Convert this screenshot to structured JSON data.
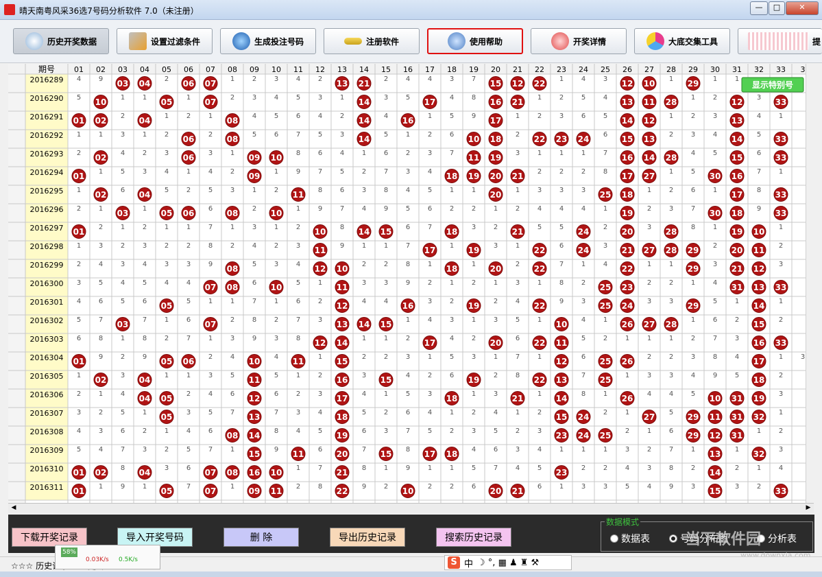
{
  "window": {
    "title": "晴天南粤风采36选7号码分析软件 7.0（未注册）",
    "controls": [
      "—",
      "□",
      "✕"
    ]
  },
  "toolbar": [
    {
      "label": "历史开奖数据",
      "icon": "history-icon",
      "pressed": true
    },
    {
      "label": "设置过滤条件",
      "icon": "tools-icon"
    },
    {
      "label": "生成投注号码",
      "icon": "globe-icon"
    },
    {
      "label": "注册软件",
      "icon": "key-icon"
    },
    {
      "label": "使用帮助",
      "icon": "help-icon",
      "highlight": true
    },
    {
      "label": "开奖详情",
      "icon": "question-icon"
    },
    {
      "label": "大底交集工具",
      "icon": "shapes-icon"
    },
    {
      "label": "提",
      "icon": "grid-icon"
    }
  ],
  "grid": {
    "header_period": "期号",
    "columns": [
      "01",
      "02",
      "03",
      "04",
      "05",
      "06",
      "07",
      "08",
      "09",
      "10",
      "11",
      "12",
      "13",
      "14",
      "15",
      "16",
      "17",
      "18",
      "19",
      "20",
      "21",
      "22",
      "23",
      "24",
      "25",
      "26",
      "27",
      "28",
      "29",
      "30",
      "31",
      "32",
      "33",
      "3"
    ],
    "show_special_label": "显示特别号",
    "rows": [
      {
        "period": "2016289",
        "cells": [
          "4",
          "9",
          "03",
          "04",
          "2",
          "06",
          "07",
          "1",
          "2",
          "3",
          "4",
          "2",
          "13",
          "21",
          "2",
          "4",
          "4",
          "3",
          "7",
          "15",
          "12",
          "22",
          "1",
          "4",
          "3",
          "12",
          "10",
          "1",
          "29",
          "1",
          "1",
          "",
          "",
          ""
        ]
      },
      {
        "period": "2016290",
        "cells": [
          "5",
          "10",
          "1",
          "1",
          "05",
          "1",
          "07",
          "2",
          "3",
          "4",
          "5",
          "3",
          "1",
          "14",
          "3",
          "5",
          "17",
          "4",
          "8",
          "16",
          "21",
          "1",
          "2",
          "5",
          "4",
          "13",
          "11",
          "28",
          "1",
          "2",
          "12",
          "3",
          "33",
          ""
        ]
      },
      {
        "period": "2016291",
        "cells": [
          "01",
          "02",
          "2",
          "04",
          "1",
          "2",
          "1",
          "08",
          "4",
          "5",
          "6",
          "4",
          "2",
          "14",
          "4",
          "16",
          "1",
          "5",
          "9",
          "17",
          "1",
          "2",
          "3",
          "6",
          "5",
          "14",
          "12",
          "1",
          "2",
          "3",
          "13",
          "4",
          "1",
          ""
        ]
      },
      {
        "period": "2016292",
        "cells": [
          "1",
          "1",
          "3",
          "1",
          "2",
          "06",
          "2",
          "08",
          "5",
          "6",
          "7",
          "5",
          "3",
          "14",
          "5",
          "1",
          "2",
          "6",
          "10",
          "18",
          "2",
          "22",
          "23",
          "24",
          "6",
          "15",
          "13",
          "2",
          "3",
          "4",
          "14",
          "5",
          "33",
          ""
        ]
      },
      {
        "period": "2016293",
        "cells": [
          "2",
          "02",
          "4",
          "2",
          "3",
          "06",
          "3",
          "1",
          "09",
          "10",
          "8",
          "6",
          "4",
          "1",
          "6",
          "2",
          "3",
          "7",
          "11",
          "19",
          "3",
          "1",
          "1",
          "1",
          "7",
          "16",
          "14",
          "28",
          "4",
          "5",
          "15",
          "6",
          "33",
          ""
        ]
      },
      {
        "period": "2016294",
        "cells": [
          "01",
          "1",
          "5",
          "3",
          "4",
          "1",
          "4",
          "2",
          "09",
          "1",
          "9",
          "7",
          "5",
          "2",
          "7",
          "3",
          "4",
          "18",
          "19",
          "20",
          "21",
          "2",
          "2",
          "2",
          "8",
          "17",
          "27",
          "1",
          "5",
          "30",
          "16",
          "7",
          "1",
          ""
        ]
      },
      {
        "period": "2016295",
        "cells": [
          "1",
          "02",
          "6",
          "04",
          "5",
          "2",
          "5",
          "3",
          "1",
          "2",
          "11",
          "8",
          "6",
          "3",
          "8",
          "4",
          "5",
          "1",
          "1",
          "20",
          "1",
          "3",
          "3",
          "3",
          "25",
          "18",
          "1",
          "2",
          "6",
          "1",
          "17",
          "8",
          "33",
          ""
        ]
      },
      {
        "period": "2016296",
        "cells": [
          "2",
          "1",
          "03",
          "1",
          "05",
          "06",
          "6",
          "08",
          "2",
          "10",
          "1",
          "9",
          "7",
          "4",
          "9",
          "5",
          "6",
          "2",
          "2",
          "1",
          "2",
          "4",
          "4",
          "4",
          "1",
          "19",
          "2",
          "3",
          "7",
          "30",
          "18",
          "9",
          "33",
          ""
        ]
      },
      {
        "period": "2016297",
        "cells": [
          "01",
          "2",
          "1",
          "2",
          "1",
          "1",
          "7",
          "1",
          "3",
          "1",
          "2",
          "10",
          "8",
          "14",
          "15",
          "6",
          "7",
          "18",
          "3",
          "2",
          "21",
          "5",
          "5",
          "24",
          "2",
          "20",
          "3",
          "28",
          "8",
          "1",
          "19",
          "10",
          "1",
          ""
        ]
      },
      {
        "period": "2016298",
        "cells": [
          "1",
          "3",
          "2",
          "3",
          "2",
          "2",
          "8",
          "2",
          "4",
          "2",
          "3",
          "11",
          "9",
          "1",
          "1",
          "7",
          "17",
          "1",
          "19",
          "3",
          "1",
          "22",
          "6",
          "24",
          "3",
          "21",
          "27",
          "28",
          "29",
          "2",
          "20",
          "11",
          "2",
          ""
        ]
      },
      {
        "period": "2016299",
        "cells": [
          "2",
          "4",
          "3",
          "4",
          "3",
          "3",
          "9",
          "08",
          "5",
          "3",
          "4",
          "12",
          "10",
          "2",
          "2",
          "8",
          "1",
          "18",
          "1",
          "20",
          "2",
          "22",
          "7",
          "1",
          "4",
          "22",
          "1",
          "1",
          "29",
          "3",
          "21",
          "12",
          "3",
          ""
        ]
      },
      {
        "period": "2016300",
        "cells": [
          "3",
          "5",
          "4",
          "5",
          "4",
          "4",
          "07",
          "08",
          "6",
          "10",
          "5",
          "1",
          "11",
          "3",
          "3",
          "9",
          "2",
          "1",
          "2",
          "1",
          "3",
          "1",
          "8",
          "2",
          "25",
          "23",
          "2",
          "2",
          "1",
          "4",
          "31",
          "13",
          "33",
          ""
        ]
      },
      {
        "period": "2016301",
        "cells": [
          "4",
          "6",
          "5",
          "6",
          "05",
          "5",
          "1",
          "1",
          "7",
          "1",
          "6",
          "2",
          "12",
          "4",
          "4",
          "16",
          "3",
          "2",
          "19",
          "2",
          "4",
          "22",
          "9",
          "3",
          "25",
          "24",
          "3",
          "3",
          "29",
          "5",
          "1",
          "14",
          "1",
          ""
        ]
      },
      {
        "period": "2016302",
        "cells": [
          "5",
          "7",
          "03",
          "7",
          "1",
          "6",
          "07",
          "2",
          "8",
          "2",
          "7",
          "3",
          "13",
          "14",
          "15",
          "1",
          "4",
          "3",
          "1",
          "3",
          "5",
          "1",
          "10",
          "4",
          "1",
          "26",
          "27",
          "28",
          "1",
          "6",
          "2",
          "15",
          "2",
          ""
        ]
      },
      {
        "period": "2016303",
        "cells": [
          "6",
          "8",
          "1",
          "8",
          "2",
          "7",
          "1",
          "3",
          "9",
          "3",
          "8",
          "12",
          "14",
          "1",
          "1",
          "2",
          "17",
          "4",
          "2",
          "20",
          "6",
          "22",
          "11",
          "5",
          "2",
          "1",
          "1",
          "1",
          "2",
          "7",
          "3",
          "16",
          "33",
          ""
        ]
      },
      {
        "period": "2016304",
        "cells": [
          "01",
          "9",
          "2",
          "9",
          "05",
          "06",
          "2",
          "4",
          "10",
          "4",
          "11",
          "1",
          "15",
          "2",
          "2",
          "3",
          "1",
          "5",
          "3",
          "1",
          "7",
          "1",
          "12",
          "6",
          "25",
          "26",
          "2",
          "2",
          "3",
          "8",
          "4",
          "17",
          "1",
          "3"
        ]
      },
      {
        "period": "2016305",
        "cells": [
          "1",
          "02",
          "3",
          "04",
          "1",
          "1",
          "3",
          "5",
          "11",
          "5",
          "1",
          "2",
          "16",
          "3",
          "15",
          "4",
          "2",
          "6",
          "19",
          "2",
          "8",
          "22",
          "13",
          "7",
          "25",
          "1",
          "3",
          "3",
          "4",
          "9",
          "5",
          "18",
          "2",
          ""
        ]
      },
      {
        "period": "2016306",
        "cells": [
          "2",
          "1",
          "4",
          "04",
          "05",
          "2",
          "4",
          "6",
          "12",
          "6",
          "2",
          "3",
          "17",
          "4",
          "1",
          "5",
          "3",
          "18",
          "1",
          "3",
          "21",
          "1",
          "14",
          "8",
          "1",
          "26",
          "4",
          "4",
          "5",
          "10",
          "31",
          "19",
          "3",
          ""
        ]
      },
      {
        "period": "2016307",
        "cells": [
          "3",
          "2",
          "5",
          "1",
          "05",
          "3",
          "5",
          "7",
          "13",
          "7",
          "3",
          "4",
          "18",
          "5",
          "2",
          "6",
          "4",
          "1",
          "2",
          "4",
          "1",
          "2",
          "15",
          "24",
          "2",
          "1",
          "27",
          "5",
          "29",
          "11",
          "31",
          "32",
          "1",
          ""
        ]
      },
      {
        "period": "2016308",
        "cells": [
          "4",
          "3",
          "6",
          "2",
          "1",
          "4",
          "6",
          "08",
          "14",
          "8",
          "4",
          "5",
          "19",
          "6",
          "3",
          "7",
          "5",
          "2",
          "3",
          "5",
          "2",
          "3",
          "23",
          "24",
          "25",
          "2",
          "1",
          "6",
          "29",
          "12",
          "31",
          "1",
          "2",
          ""
        ]
      },
      {
        "period": "2016309",
        "cells": [
          "5",
          "4",
          "7",
          "3",
          "2",
          "5",
          "7",
          "1",
          "15",
          "9",
          "11",
          "6",
          "20",
          "7",
          "15",
          "8",
          "17",
          "18",
          "4",
          "6",
          "3",
          "4",
          "1",
          "1",
          "1",
          "3",
          "2",
          "7",
          "1",
          "13",
          "1",
          "32",
          "3",
          ""
        ]
      },
      {
        "period": "2016310",
        "cells": [
          "01",
          "02",
          "8",
          "04",
          "3",
          "6",
          "07",
          "08",
          "16",
          "10",
          "1",
          "7",
          "21",
          "8",
          "1",
          "9",
          "1",
          "1",
          "5",
          "7",
          "4",
          "5",
          "23",
          "2",
          "2",
          "4",
          "3",
          "8",
          "2",
          "14",
          "2",
          "1",
          "4",
          ""
        ]
      },
      {
        "period": "2016311",
        "cells": [
          "01",
          "1",
          "9",
          "1",
          "05",
          "7",
          "07",
          "1",
          "09",
          "11",
          "2",
          "8",
          "22",
          "9",
          "2",
          "10",
          "2",
          "2",
          "6",
          "20",
          "21",
          "6",
          "1",
          "3",
          "3",
          "5",
          "4",
          "9",
          "3",
          "15",
          "3",
          "2",
          "33",
          ""
        ]
      }
    ]
  },
  "bottom_buttons": [
    {
      "label": "下载开奖记录",
      "color": "#f7c3c8"
    },
    {
      "label": "导入开奖号码",
      "color": "#c8f4f4"
    },
    {
      "label": "删  除",
      "color": "#c8c8f8"
    },
    {
      "label": "导出历史记录",
      "color": "#f8d8b8"
    },
    {
      "label": "搜索历史记录",
      "color": "#f4c4f0"
    }
  ],
  "data_mode": {
    "legend": "数据模式",
    "options": [
      {
        "label": "数据表",
        "selected": false
      },
      {
        "label": "号码分布图",
        "selected": true
      },
      {
        "label": "分析表",
        "selected": false
      }
    ]
  },
  "statusbar": {
    "text": "☆☆☆  历史记录：  已更新：  ☆☆☆"
  },
  "netmon": {
    "percent": "58%",
    "up": "0.03K/s",
    "down": "0.5K/s"
  },
  "ime": {
    "logo": "S",
    "lang": "中",
    "icons": "☽ °, ▦ ♟ ♜ ⚒"
  },
  "watermark": {
    "main": "当下软件园",
    "sub": "www.downxia.com"
  },
  "colors": {
    "ball": "#b01414",
    "period_bg": "#fffbc8",
    "show_special_bg": "#52d052",
    "highlight_border": "#e01010"
  }
}
